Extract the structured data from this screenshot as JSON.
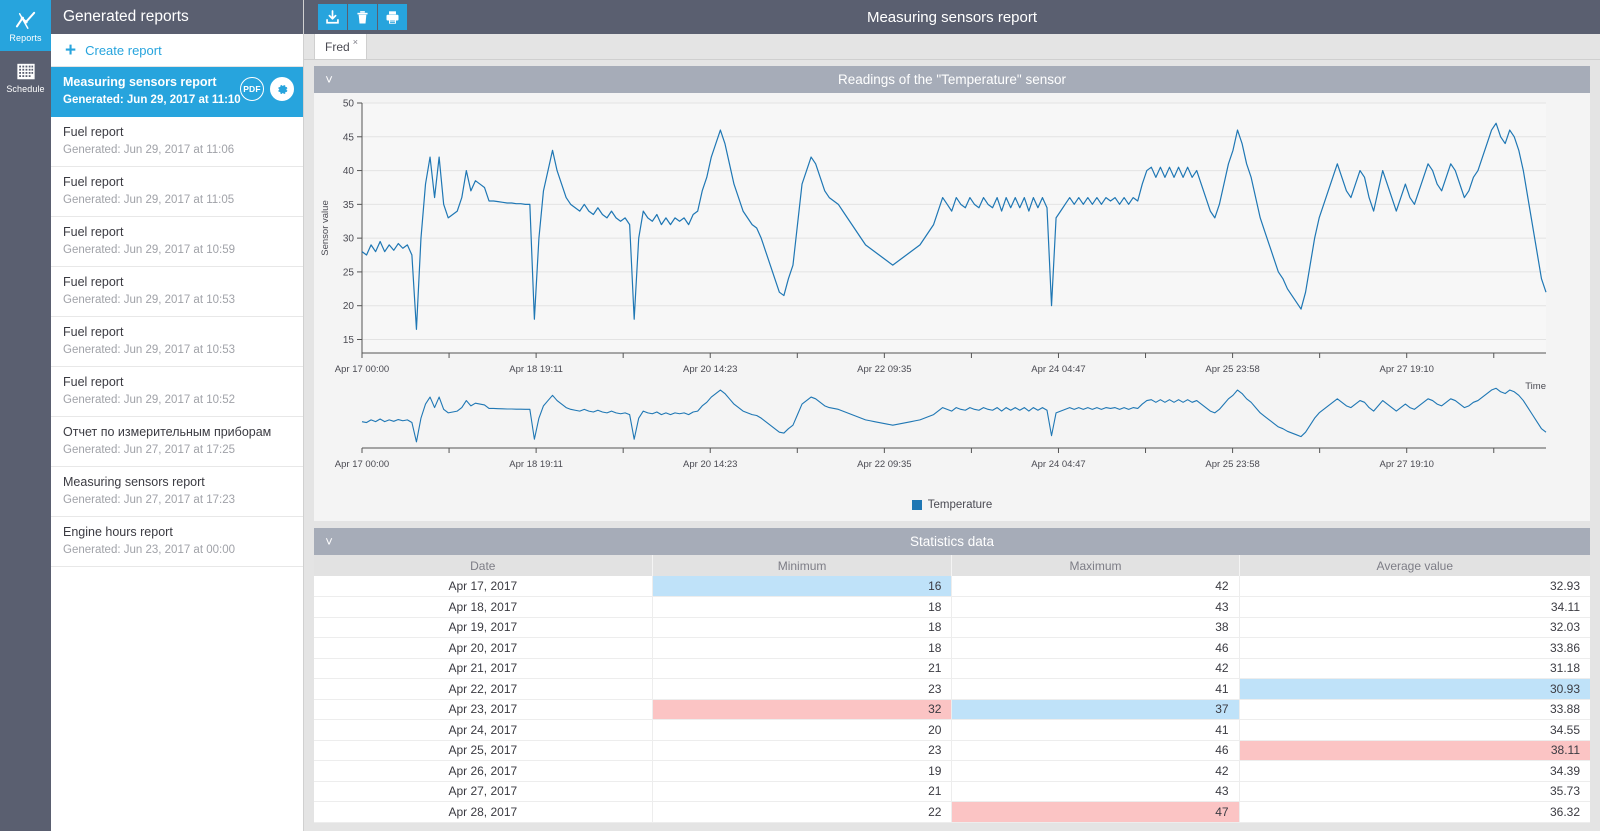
{
  "rail": {
    "items": [
      {
        "label": "Reports",
        "icon": "chart-line-icon",
        "active": true
      },
      {
        "label": "Schedule",
        "icon": "calendar-grid-icon",
        "active": false
      }
    ]
  },
  "sidebar": {
    "header": "Generated reports",
    "create_label": "Create report",
    "create_icon": "plus-icon",
    "pdf_badge": "PDF",
    "gear_icon": "gear-icon",
    "items": [
      {
        "title": "Measuring sensors report",
        "sub": "Generated: Jun 29, 2017 at 11:10",
        "selected": true
      },
      {
        "title": "Fuel report",
        "sub": "Generated: Jun 29, 2017 at 11:06",
        "selected": false
      },
      {
        "title": "Fuel report",
        "sub": "Generated: Jun 29, 2017 at 11:05",
        "selected": false
      },
      {
        "title": "Fuel report",
        "sub": "Generated: Jun 29, 2017 at 10:59",
        "selected": false
      },
      {
        "title": "Fuel report",
        "sub": "Generated: Jun 29, 2017 at 10:53",
        "selected": false
      },
      {
        "title": "Fuel report",
        "sub": "Generated: Jun 29, 2017 at 10:53",
        "selected": false
      },
      {
        "title": "Fuel report",
        "sub": "Generated: Jun 29, 2017 at 10:52",
        "selected": false
      },
      {
        "title": "Отчет по измерительным приборам",
        "sub": "Generated: Jun 27, 2017 at 17:25",
        "selected": false
      },
      {
        "title": "Measuring sensors report",
        "sub": "Generated: Jun 27, 2017 at 17:23",
        "selected": false
      },
      {
        "title": "Engine hours report",
        "sub": "Generated: Jun 23, 2017 at 00:00",
        "selected": false
      }
    ]
  },
  "topbar": {
    "title": "Measuring sensors report",
    "tools": [
      {
        "name": "export-download-button",
        "icon": "download-icon"
      },
      {
        "name": "delete-button",
        "icon": "trash-icon"
      },
      {
        "name": "print-button",
        "icon": "printer-icon"
      }
    ]
  },
  "tabs": [
    {
      "label": "Fred",
      "close": "×",
      "active": true
    }
  ],
  "panels": {
    "chart": {
      "title": "Readings of the \"Temperature\" sensor",
      "caret": "˅"
    },
    "stats": {
      "title": "Statistics data",
      "caret": "˅"
    }
  },
  "table": {
    "columns": [
      "Date",
      "Minimum",
      "Maximum",
      "Average value"
    ],
    "rows": [
      {
        "date": "Apr 17, 2017",
        "min": "16",
        "max": "42",
        "avg": "32.93",
        "hl": {
          "min": "low"
        }
      },
      {
        "date": "Apr 18, 2017",
        "min": "18",
        "max": "43",
        "avg": "34.11",
        "hl": {}
      },
      {
        "date": "Apr 19, 2017",
        "min": "18",
        "max": "38",
        "avg": "32.03",
        "hl": {}
      },
      {
        "date": "Apr 20, 2017",
        "min": "18",
        "max": "46",
        "avg": "33.86",
        "hl": {}
      },
      {
        "date": "Apr 21, 2017",
        "min": "21",
        "max": "42",
        "avg": "31.18",
        "hl": {}
      },
      {
        "date": "Apr 22, 2017",
        "min": "23",
        "max": "41",
        "avg": "30.93",
        "hl": {
          "avg": "low"
        }
      },
      {
        "date": "Apr 23, 2017",
        "min": "32",
        "max": "37",
        "avg": "33.88",
        "hl": {
          "min": "high",
          "max": "low"
        }
      },
      {
        "date": "Apr 24, 2017",
        "min": "20",
        "max": "41",
        "avg": "34.55",
        "hl": {}
      },
      {
        "date": "Apr 25, 2017",
        "min": "23",
        "max": "46",
        "avg": "38.11",
        "hl": {
          "avg": "high"
        }
      },
      {
        "date": "Apr 26, 2017",
        "min": "19",
        "max": "42",
        "avg": "34.39",
        "hl": {}
      },
      {
        "date": "Apr 27, 2017",
        "min": "21",
        "max": "43",
        "avg": "35.73",
        "hl": {}
      },
      {
        "date": "Apr 28, 2017",
        "min": "22",
        "max": "47",
        "avg": "36.32",
        "hl": {
          "max": "high"
        }
      }
    ]
  },
  "chart_data": {
    "type": "line",
    "title": "Readings of the \"Temperature\" sensor",
    "xlabel": "Time",
    "ylabel": "Sensor value",
    "ylim": [
      13,
      50
    ],
    "yticks": [
      15,
      20,
      25,
      30,
      35,
      40,
      45,
      50
    ],
    "xticks": [
      "Apr 17 00:00",
      "Apr 18 19:11",
      "Apr 20 14:23",
      "Apr 22 09:35",
      "Apr 24 04:47",
      "Apr 25 23:58",
      "Apr 27 19:10"
    ],
    "grid": true,
    "legend": {
      "position": "bottom",
      "entries": [
        {
          "name": "Temperature",
          "color": "#1f77b4"
        }
      ]
    },
    "series": [
      {
        "name": "Temperature",
        "color": "#1f77b4",
        "values": [
          28,
          27.5,
          29,
          28,
          29.5,
          28,
          29,
          28.2,
          29.2,
          28.5,
          29,
          27.5,
          16.5,
          30,
          38,
          42,
          36,
          42,
          35,
          33,
          33.5,
          34,
          36,
          40,
          37,
          38.5,
          38,
          37.5,
          35.5,
          35.5,
          35.4,
          35.3,
          35.2,
          35.2,
          35.1,
          35.1,
          35,
          35,
          18,
          30,
          37,
          40,
          43,
          40,
          38,
          36,
          35,
          34.5,
          34,
          35,
          34,
          33.5,
          34.5,
          33.5,
          33,
          34,
          33,
          32.5,
          33,
          32,
          18,
          30,
          34,
          33,
          32.5,
          33.5,
          32,
          33,
          32,
          33,
          32.5,
          33,
          32,
          33.5,
          34,
          37,
          39,
          42,
          44,
          46,
          44,
          41,
          38,
          36,
          34,
          33,
          32,
          31.5,
          30,
          28,
          26,
          24,
          22,
          21.5,
          24,
          26,
          32,
          38,
          40,
          42,
          41,
          39,
          37,
          36,
          35.5,
          35,
          34,
          33,
          32,
          31,
          30,
          29,
          28.5,
          28,
          27.5,
          27,
          26.5,
          26,
          26.5,
          27,
          27.5,
          28,
          28.5,
          29,
          30,
          31,
          32,
          34,
          36,
          35,
          34,
          36,
          35,
          34.5,
          36,
          35,
          34.5,
          36,
          35,
          34.5,
          36,
          34,
          36,
          34.5,
          36,
          34.5,
          36,
          34,
          36,
          34.5,
          36,
          34.5,
          20,
          33,
          34,
          35,
          36,
          35,
          36,
          35,
          36,
          35,
          36,
          35,
          36,
          35.5,
          36,
          35,
          36,
          35,
          36,
          35.5,
          38,
          40,
          40.5,
          39,
          40.5,
          39,
          40.5,
          39,
          40.5,
          39,
          40.5,
          39,
          40,
          38,
          36,
          34,
          33,
          35,
          38,
          41,
          43,
          46,
          44,
          41,
          39,
          36,
          33,
          31,
          29,
          27,
          25,
          24,
          22.5,
          21.5,
          20.5,
          19.5,
          22,
          26,
          30,
          33,
          35,
          37,
          39,
          41,
          39,
          37,
          36,
          38,
          40,
          39,
          36,
          34,
          37,
          40,
          38,
          36,
          34,
          36,
          38,
          36,
          35,
          37,
          39,
          41,
          40,
          38,
          37,
          39,
          41,
          40,
          38,
          36,
          37,
          39,
          40,
          42,
          44,
          46,
          47,
          45,
          44,
          46,
          45,
          43,
          40,
          36,
          32,
          28,
          24,
          22
        ]
      }
    ],
    "navigator": {
      "enabled": true,
      "xticks": [
        "Apr 17 00:00",
        "Apr 18 19:11",
        "Apr 20 14:23",
        "Apr 22 09:35",
        "Apr 24 04:47",
        "Apr 25 23:58",
        "Apr 27 19:10"
      ]
    }
  }
}
